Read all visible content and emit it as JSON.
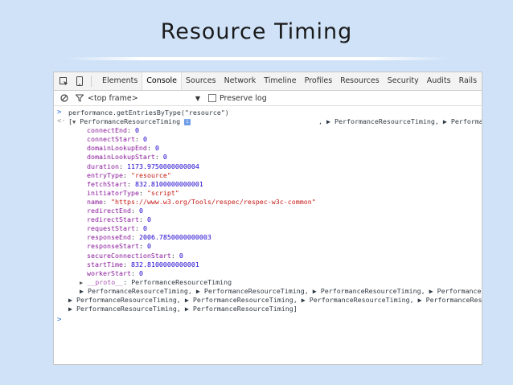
{
  "slide": {
    "title": "Resource Timing"
  },
  "devtools": {
    "tabs": [
      "Elements",
      "Console",
      "Sources",
      "Network",
      "Timeline",
      "Profiles",
      "Resources",
      "Security",
      "Audits",
      "Rails"
    ],
    "active_tab": "Console",
    "frame_selector": "<top frame>",
    "preserve_log_label": "Preserve log"
  },
  "console": {
    "input_command": "performance.getEntriesByType(\"resource\")",
    "result_header": {
      "open_bracket": "[",
      "label": "PerformanceResourceTiming",
      "trailing": ", ▶ PerformanceResourceTiming, ▶ Performa"
    },
    "properties": [
      {
        "key": "connectEnd",
        "value": "0",
        "kind": "num"
      },
      {
        "key": "connectStart",
        "value": "0",
        "kind": "num"
      },
      {
        "key": "domainLookupEnd",
        "value": "0",
        "kind": "num"
      },
      {
        "key": "domainLookupStart",
        "value": "0",
        "kind": "num"
      },
      {
        "key": "duration",
        "value": "1173.9750000000004",
        "kind": "num"
      },
      {
        "key": "entryType",
        "value": "\"resource\"",
        "kind": "str"
      },
      {
        "key": "fetchStart",
        "value": "832.8100000000001",
        "kind": "num"
      },
      {
        "key": "initiatorType",
        "value": "\"script\"",
        "kind": "str"
      },
      {
        "key": "name",
        "value": "\"https://www.w3.org/Tools/respec/respec-w3c-common\"",
        "kind": "str"
      },
      {
        "key": "redirectEnd",
        "value": "0",
        "kind": "num"
      },
      {
        "key": "redirectStart",
        "value": "0",
        "kind": "num"
      },
      {
        "key": "requestStart",
        "value": "0",
        "kind": "num"
      },
      {
        "key": "responseEnd",
        "value": "2006.7850000000003",
        "kind": "num"
      },
      {
        "key": "responseStart",
        "value": "0",
        "kind": "num"
      },
      {
        "key": "secureConnectionStart",
        "value": "0",
        "kind": "num"
      },
      {
        "key": "startTime",
        "value": "832.8100000000001",
        "kind": "num"
      },
      {
        "key": "workerStart",
        "value": "0",
        "kind": "num"
      }
    ],
    "proto": {
      "key": "__proto__",
      "value": "PerformanceResourceTiming"
    },
    "collapsed_lines": [
      "▶ PerformanceResourceTiming, ▶ PerformanceResourceTiming, ▶ PerformanceResourceTiming, ▶ PerformanceReso",
      "▶ PerformanceResourceTiming, ▶ PerformanceResourceTiming, ▶ PerformanceResourceTiming, ▶ PerformanceReso",
      "▶ PerformanceResourceTiming, ▶ PerformanceResourceTiming]"
    ],
    "prompt_symbol": ">",
    "result_symbol": "<·",
    "info_badge": "i"
  },
  "colors": {
    "background": "#cfe2f8",
    "key": "#8a1a9b",
    "number": "#1c00cf",
    "string": "#c41a16",
    "prompt": "#1e6cd8"
  },
  "icons": [
    "inspect-icon",
    "device-icon",
    "clear-console-icon",
    "filter-icon"
  ]
}
